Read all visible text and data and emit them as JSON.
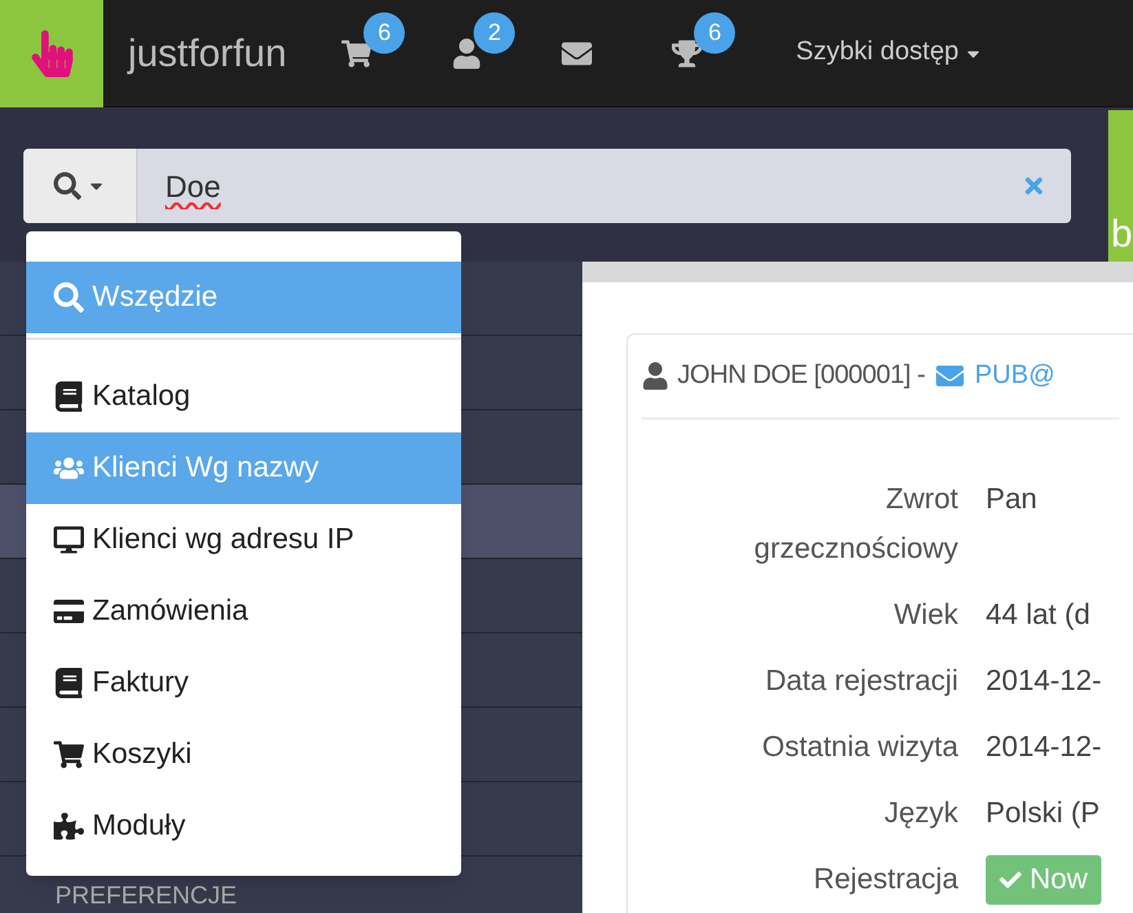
{
  "app": {
    "name": "justforfun"
  },
  "header_icons": [
    {
      "kind": "cart",
      "badge": "6"
    },
    {
      "kind": "user",
      "badge": "2"
    },
    {
      "kind": "mail"
    },
    {
      "kind": "trophy",
      "badge": "6"
    }
  ],
  "quick_access": {
    "label": "Szybki dostęp"
  },
  "search": {
    "value": "Doe"
  },
  "side_tab": {
    "label": "b"
  },
  "sidebar": {
    "items": [
      {
        "selected": false
      },
      {
        "selected": false
      },
      {
        "selected": false
      },
      {
        "selected": true
      },
      {
        "selected": false
      },
      {
        "selected": false
      },
      {
        "selected": false
      },
      {
        "selected": false
      },
      {
        "label": "PREFERENCJE",
        "selected": false
      }
    ]
  },
  "search_menu": {
    "groups": [
      {
        "items": [
          {
            "kind": "search",
            "label": "Wszędzie",
            "selected": true
          }
        ]
      },
      {
        "items": [
          {
            "kind": "book",
            "label": "Katalog",
            "selected": false
          },
          {
            "kind": "users",
            "label": "Klienci Wg nazwy",
            "selected": true
          },
          {
            "kind": "desktop",
            "label": "Klienci wg adresu IP",
            "selected": false
          },
          {
            "kind": "card",
            "label": "Zamówienia",
            "selected": false
          },
          {
            "kind": "book",
            "label": "Faktury",
            "selected": false
          },
          {
            "kind": "cart",
            "label": "Koszyki",
            "selected": false
          },
          {
            "kind": "puzzle",
            "label": "Moduły",
            "selected": false
          }
        ]
      }
    ]
  },
  "customer": {
    "name": "JOHN DOE [000001] -",
    "email": "PUB@",
    "fields": [
      {
        "kind": "text",
        "label": "Zwrot grzecznościowy",
        "value": "Pan"
      },
      {
        "kind": "text",
        "label": "Wiek",
        "value": "44 lat (d"
      },
      {
        "kind": "text",
        "label": "Data rejestracji",
        "value": "2014-12-"
      },
      {
        "kind": "text",
        "label": "Ostatnia wizyta",
        "value": "2014-12-"
      },
      {
        "kind": "text",
        "label": "Język",
        "value": "Polski (P"
      },
      {
        "kind": "button",
        "label": "Rejestracja",
        "value": "Now"
      }
    ]
  }
}
